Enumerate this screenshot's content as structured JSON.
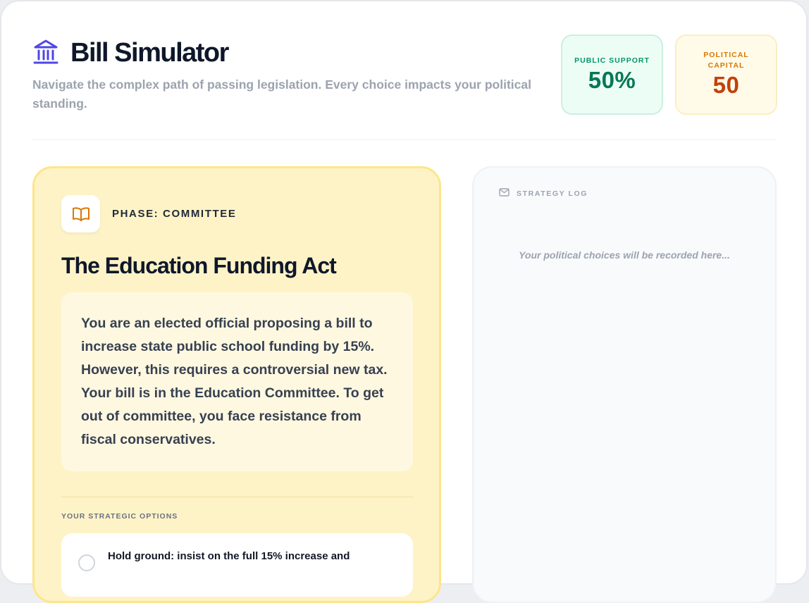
{
  "header": {
    "title": "Bill Simulator",
    "subtitle": "Navigate the complex path of passing legislation. Every choice impacts your political standing.",
    "icon": "capitol-building-icon"
  },
  "stats": {
    "public_support": {
      "label": "PUBLIC SUPPORT",
      "value": "50%",
      "color": "#047857"
    },
    "political_capital": {
      "label": "POLITICAL CAPITAL",
      "value": "50",
      "color": "#c2410c"
    }
  },
  "scenario": {
    "phase": "PHASE: COMMITTEE",
    "phase_icon": "open-book-icon",
    "bill_title": "The Education Funding Act",
    "description": "You are an elected official proposing a bill to increase state public school funding by 15%. However, this requires a controversial new tax. Your bill is in the Education Committee. To get out of committee, you face resistance from fiscal conservatives.",
    "options_label": "YOUR STRATEGIC OPTIONS",
    "options": [
      {
        "text": "Hold ground: insist on the full 15% increase and"
      }
    ]
  },
  "log": {
    "title": "STRATEGY LOG",
    "icon": "mail-icon",
    "empty_message": "Your political choices will be recorded here..."
  },
  "colors": {
    "accent": "#4f46e5",
    "scenario_bg": "#fef3c7",
    "scenario_border": "#fde68a",
    "phase_icon": "#d97706"
  }
}
